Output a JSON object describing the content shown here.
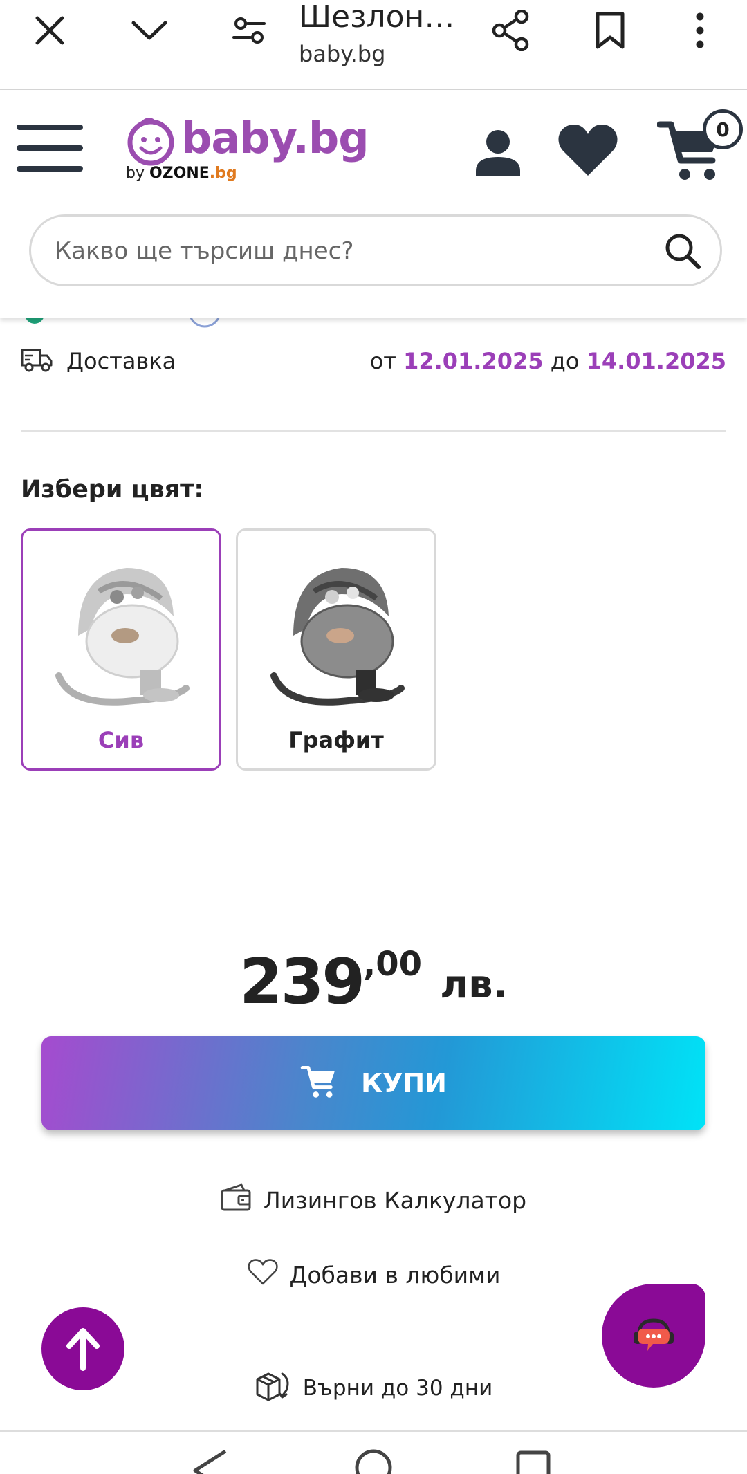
{
  "browser": {
    "title": "Шезлонг...",
    "url": "baby.bg",
    "icons": [
      "close-icon",
      "chevron-down-icon",
      "tune-icon",
      "share-icon",
      "bookmark-icon",
      "more-vert-icon"
    ]
  },
  "header": {
    "logo_word": "baby.bg",
    "logo_by": "by",
    "logo_ozone": "OZONE",
    "logo_bg": ".bg",
    "cart_count": "0",
    "search": {
      "placeholder": "Какво ще търсиш днес?"
    },
    "brand_color": "#9b4db0"
  },
  "delivery": {
    "label": "Доставка",
    "from_word": "от",
    "from_date": "12.01.2025",
    "to_word": "до",
    "to_date": "14.01.2025"
  },
  "color_picker": {
    "title": "Избери цвят:",
    "options": [
      {
        "label": "Сив",
        "selected": true
      },
      {
        "label": "Графит",
        "selected": false
      }
    ],
    "accent": "#9b3fb8"
  },
  "price": {
    "integer": "239",
    "decimal": ",00",
    "currency": "лв."
  },
  "actions": {
    "buy_label": "КУПИ",
    "leasing_label": "Лизингов Калкулатор",
    "favorite_label": "Добави в любими",
    "return_label": "Върни до 30 дни"
  },
  "floating": {
    "scroll_top_color": "#8a0a96",
    "chat_color": "#8a0a96"
  }
}
